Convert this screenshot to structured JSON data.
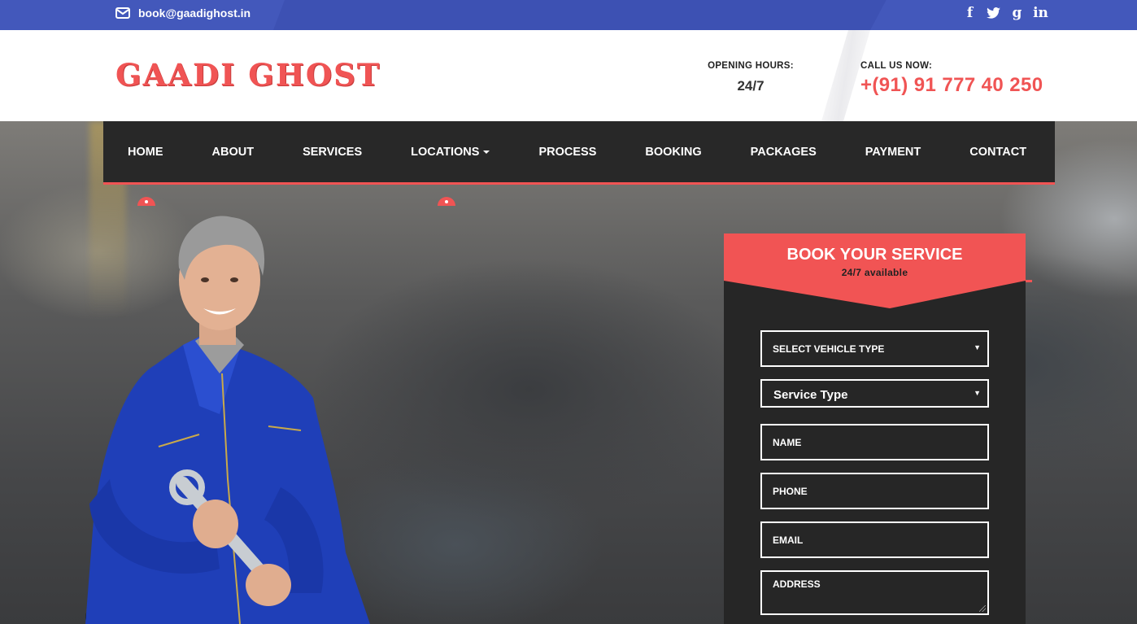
{
  "topbar": {
    "email": "book@gaadighost.in",
    "socials": [
      {
        "icon": "facebook-icon",
        "glyph": "f"
      },
      {
        "icon": "twitter-icon",
        "glyph": "t"
      },
      {
        "icon": "google-plus-icon",
        "glyph": "g"
      },
      {
        "icon": "linkedin-icon",
        "glyph": "in"
      }
    ]
  },
  "header": {
    "logo": "GAADI GHOST",
    "opening_label": "OPENING HOURS:",
    "opening_value": "24/7",
    "call_label": "CALL US NOW:",
    "call_value": "+(91) 91 777 40 250"
  },
  "nav": {
    "items": [
      {
        "label": "HOME",
        "active": true
      },
      {
        "label": "ABOUT"
      },
      {
        "label": "SERVICES"
      },
      {
        "label": "LOCATIONS",
        "dropdown": true
      },
      {
        "label": "PROCESS"
      },
      {
        "label": "BOOKING"
      },
      {
        "label": "PACKAGES"
      },
      {
        "label": "PAYMENT"
      },
      {
        "label": "CONTACT"
      }
    ]
  },
  "booking": {
    "title": "BOOK YOUR SERVICE",
    "subtitle": "24/7 available",
    "vehicle_select": "SELECT VEHICLE TYPE",
    "service_select": "Service Type",
    "name_placeholder": "NAME",
    "phone_placeholder": "PHONE",
    "email_placeholder": "EMAIL",
    "address_placeholder": "ADDRESS"
  },
  "colors": {
    "accent": "#f05454",
    "topbar": "#3d51b3",
    "nav_bg": "#282828",
    "panel_bg": "#262626"
  }
}
